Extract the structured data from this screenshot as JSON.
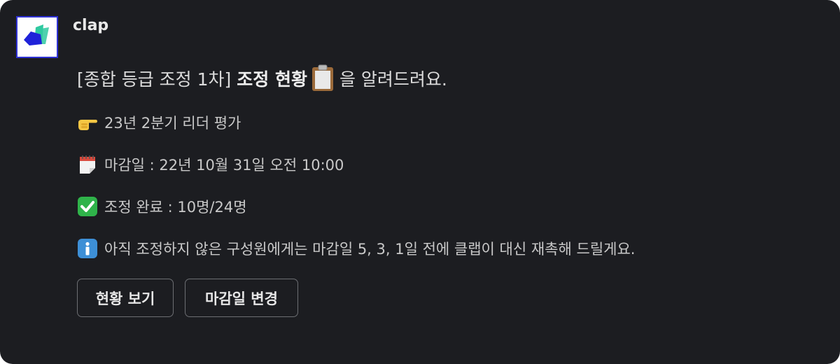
{
  "message": {
    "sender": "clap",
    "title_prefix": "[종합 등급 조정 1차]",
    "title_bold": "조정 현황",
    "title_suffix": "을 알려드려요.",
    "items": [
      {
        "icon": "pointing-hand-icon",
        "text": "23년 2분기 리더 평가"
      },
      {
        "icon": "calendar-icon",
        "text": "마감일 : 22년 10월 31일 오전 10:00"
      },
      {
        "icon": "check-mark-icon",
        "text": "조정 완료 : 10명/24명"
      },
      {
        "icon": "information-icon",
        "text": "아직 조정하지 않은 구성원에게는 마감일 5, 3, 1일 전에 클랩이 대신 재촉해 드릴게요."
      }
    ]
  },
  "buttons": {
    "view_status": "현황 보기",
    "change_deadline": "마감일 변경"
  },
  "colors": {
    "background": "#1c1d21",
    "logo_blue": "#1f22d9",
    "logo_green": "#2fc9a0",
    "check_green": "#2fb34a",
    "info_blue": "#3d8fd6"
  }
}
